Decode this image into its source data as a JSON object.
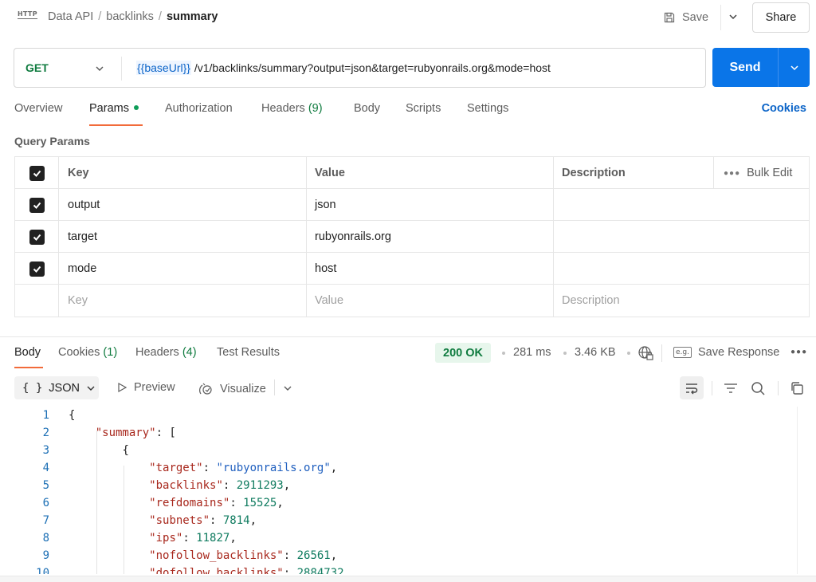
{
  "breadcrumb": {
    "items": [
      "Data API",
      "backlinks"
    ],
    "current": "summary",
    "icon_text": "HTTP"
  },
  "toolbar": {
    "save_label": "Save",
    "share_label": "Share"
  },
  "request": {
    "method": "GET",
    "url_variable": "{{baseUrl}}",
    "url_path": "/v1/backlinks/summary?output=json&target=rubyonrails.org&mode=host",
    "send_label": "Send"
  },
  "request_tabs": {
    "overview": "Overview",
    "params": "Params",
    "authorization": "Authorization",
    "headers": "Headers",
    "headers_count": "(9)",
    "body": "Body",
    "scripts": "Scripts",
    "settings": "Settings",
    "cookies": "Cookies"
  },
  "query_params": {
    "title": "Query Params",
    "columns": {
      "key": "Key",
      "value": "Value",
      "description": "Description",
      "bulk_edit": "Bulk Edit"
    },
    "rows": [
      {
        "key": "output",
        "value": "json",
        "description": ""
      },
      {
        "key": "target",
        "value": "rubyonrails.org",
        "description": ""
      },
      {
        "key": "mode",
        "value": "host",
        "description": ""
      }
    ],
    "placeholders": {
      "key": "Key",
      "value": "Value",
      "description": "Description"
    }
  },
  "response_tabs": {
    "body": "Body",
    "cookies": "Cookies",
    "cookies_count": "(1)",
    "headers": "Headers",
    "headers_count": "(4)",
    "test_results": "Test Results"
  },
  "response_meta": {
    "status": "200 OK",
    "time": "281 ms",
    "size": "3.46 KB",
    "save_response": "Save Response",
    "eg_label": "e.g."
  },
  "response_toolbar": {
    "format": "JSON",
    "preview": "Preview",
    "visualize": "Visualize"
  },
  "code_lines": [
    {
      "n": "1",
      "indent": "",
      "parts": [
        [
          "p",
          "{"
        ]
      ]
    },
    {
      "n": "2",
      "indent": "    ",
      "parts": [
        [
          "k",
          "\"summary\""
        ],
        [
          "p",
          ": ["
        ]
      ]
    },
    {
      "n": "3",
      "indent": "        ",
      "parts": [
        [
          "p",
          "{"
        ]
      ]
    },
    {
      "n": "4",
      "indent": "            ",
      "parts": [
        [
          "k",
          "\"target\""
        ],
        [
          "p",
          ": "
        ],
        [
          "s",
          "\"rubyonrails.org\""
        ],
        [
          "p",
          ","
        ]
      ]
    },
    {
      "n": "5",
      "indent": "            ",
      "parts": [
        [
          "k",
          "\"backlinks\""
        ],
        [
          "p",
          ": "
        ],
        [
          "n",
          "2911293"
        ],
        [
          "p",
          ","
        ]
      ]
    },
    {
      "n": "6",
      "indent": "            ",
      "parts": [
        [
          "k",
          "\"refdomains\""
        ],
        [
          "p",
          ": "
        ],
        [
          "n",
          "15525"
        ],
        [
          "p",
          ","
        ]
      ]
    },
    {
      "n": "7",
      "indent": "            ",
      "parts": [
        [
          "k",
          "\"subnets\""
        ],
        [
          "p",
          ": "
        ],
        [
          "n",
          "7814"
        ],
        [
          "p",
          ","
        ]
      ]
    },
    {
      "n": "8",
      "indent": "            ",
      "parts": [
        [
          "k",
          "\"ips\""
        ],
        [
          "p",
          ": "
        ],
        [
          "n",
          "11827"
        ],
        [
          "p",
          ","
        ]
      ]
    },
    {
      "n": "9",
      "indent": "            ",
      "parts": [
        [
          "k",
          "\"nofollow_backlinks\""
        ],
        [
          "p",
          ": "
        ],
        [
          "n",
          "26561"
        ],
        [
          "p",
          ","
        ]
      ]
    },
    {
      "n": "10",
      "indent": "            ",
      "parts": [
        [
          "k",
          "\"dofollow_backlinks\""
        ],
        [
          "p",
          ": "
        ],
        [
          "n",
          "2884732"
        ],
        [
          "p",
          ","
        ]
      ]
    }
  ],
  "colors": {
    "accent": "#0a75e8",
    "method": "#0f7b3f",
    "active_tab": "#f26b3a",
    "status_bg": "#e7f6ec"
  },
  "icons": [
    "http-icon",
    "save-icon",
    "chevron-down-icon",
    "check-icon",
    "more-dots-icon",
    "globe-lock-icon",
    "example-icon",
    "play-icon",
    "visualize-icon",
    "wrap-icon",
    "filter-icon",
    "search-icon",
    "copy-icon"
  ]
}
